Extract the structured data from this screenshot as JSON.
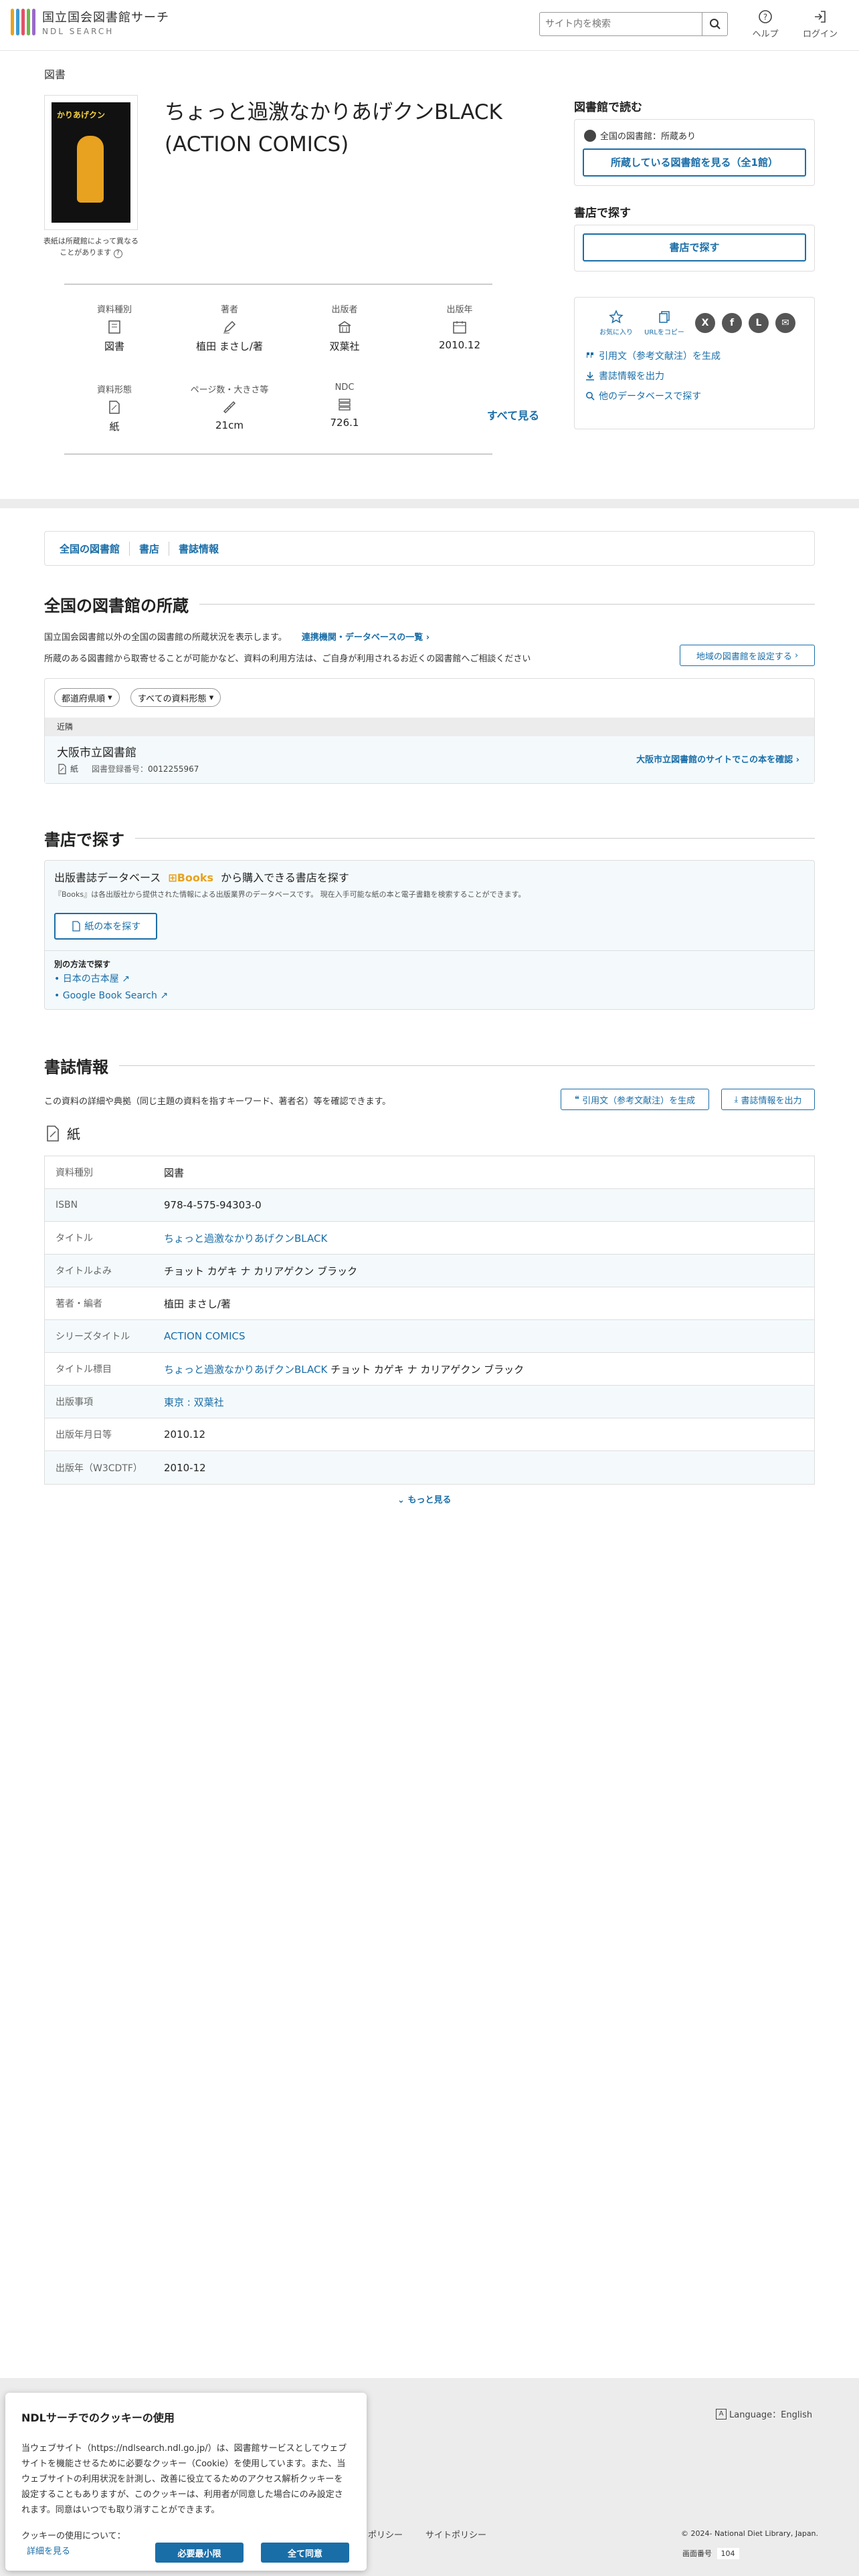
{
  "header": {
    "logo_title": "国立国会図書館サーチ",
    "logo_sub": "NDL SEARCH",
    "search_placeholder": "サイト内を検索",
    "help": "ヘルプ",
    "login": "ログイン"
  },
  "item": {
    "category": "図書",
    "title": "ちょっと過激なかりあげクンBLACK (ACTION COMICS)",
    "cover_note": "表紙は所蔵館によって異なることがあります",
    "cover_text": "かりあげクン",
    "meta": [
      {
        "label": "資料種別",
        "value": "図書",
        "icon": "book-icon"
      },
      {
        "label": "著者",
        "value": "植田 まさし/著",
        "icon": "pen-icon"
      },
      {
        "label": "出版者",
        "value": "双葉社",
        "icon": "building-icon"
      },
      {
        "label": "出版年",
        "value": "2010.12",
        "icon": "calendar-icon"
      },
      {
        "label": "資料形態",
        "value": "紙",
        "icon": "paper-icon"
      },
      {
        "label": "ページ数・大きさ等",
        "value": "21cm",
        "icon": "ruler-icon"
      },
      {
        "label": "NDC",
        "value": "726.1",
        "icon": "ndc-icon"
      }
    ],
    "see_all": "すべて見る"
  },
  "right": {
    "read_title": "図書館で読む",
    "hold_status": "全国の図書館：所蔵あり",
    "hold_button": "所蔵している図書館を見る（全1館）",
    "store_title": "書店で探す",
    "store_button": "書店で探す",
    "favorite": "お気に入り",
    "copy_url": "URLをコピー",
    "cite": "引用文（参考文献注）を生成",
    "export": "書誌情報を出力",
    "other_db": "他のデータベースで探す"
  },
  "anchors": [
    "全国の図書館",
    "書店",
    "書誌情報"
  ],
  "libraries": {
    "title": "全国の図書館の所蔵",
    "desc1": "国立国会図書館以外の全国の図書館の所蔵状況を表示します。",
    "link": "連携機関・データベースの一覧",
    "desc2": "所蔵のある図書館から取寄せることが可能かなど、資料の利用方法は、ご自身が利用されるお近くの図書館へご相談ください",
    "region_button": "地域の図書館を設定する",
    "filter_pref": "都道府県順",
    "filter_type": "すべての資料形態",
    "col_header": "近隣",
    "lib_name": "大阪市立図書館",
    "lib_form": "紙",
    "lib_reg_label": "図書登録番号：",
    "lib_reg": "0012255967",
    "lib_link": "大阪市立図書館のサイトでこの本を確認"
  },
  "store": {
    "title": "書店で探す",
    "db_label_pre": "出版書誌データベース",
    "db_name": "Books",
    "db_label_post": "から購入できる書店を探す",
    "db_desc": "『Books』は各出版社から提供された情報による出版業界のデータベースです。 現在入手可能な紙の本と電子書籍を検索することができます。",
    "paper_button": "紙の本を探す",
    "other_title": "別の方法で探す",
    "other_links": [
      "日本の古本屋",
      "Google Book Search"
    ]
  },
  "biblio": {
    "title": "書誌情報",
    "desc": "この資料の詳細や典拠（同じ主題の資料を指すキーワード、著者名）等を確認できます。",
    "cite_button": "引用文（参考文献注）を生成",
    "export_button": "書誌情報を出力",
    "form_heading": "紙",
    "rows": [
      {
        "k": "資料種別",
        "v": "図書",
        "link": false
      },
      {
        "k": "ISBN",
        "v": "978-4-575-94303-0",
        "link": false
      },
      {
        "k": "タイトル",
        "v": "ちょっと過激なかりあげクンBLACK",
        "link": true
      },
      {
        "k": "タイトルよみ",
        "v": "チョット カゲキ ナ カリアゲクン ブラック",
        "link": false
      },
      {
        "k": "著者・編者",
        "v": "植田 まさし/著",
        "link": false
      },
      {
        "k": "シリーズタイトル",
        "v": "ACTION COMICS",
        "link": true
      },
      {
        "k": "タイトル標目",
        "v": "ちょっと過激なかりあげクンBLACK",
        "v2": "チョット カゲキ ナ カリアゲクン ブラック",
        "link": true
      },
      {
        "k": "出版事項",
        "v": "東京 : 双葉社",
        "link": true
      },
      {
        "k": "出版年月日等",
        "v": "2010.12",
        "link": false
      },
      {
        "k": "出版年（W3CDTF）",
        "v": "2010-12",
        "link": false
      }
    ],
    "more": "もっと見る"
  },
  "footer": {
    "language": "Language：English",
    "policy1": "ポリシー",
    "policy2": "サイトポリシー",
    "copyright": "© 2024- National Diet Library, Japan.",
    "screen_label": "画面番号",
    "screen_no": "104"
  },
  "cookie": {
    "title": "NDLサーチでのクッキーの使用",
    "body": "当ウェブサイト（https://ndlsearch.ndl.go.jp/）は、図書館サービスとしてウェブサイトを機能させるために必要なクッキー（Cookie）を使用しています。また、当ウェブサイトの利用状況を計測し、改善に役立てるためのアクセス解析クッキーを設定することもありますが、このクッキーは、利用者が同意した場合にのみ設定されます。同意はいつでも取り消すことができます。",
    "about": "クッキーの使用について：",
    "details": "詳細を見る",
    "necessary": "必要最小限",
    "accept_all": "全て同意"
  },
  "colors": {
    "accent": "#1a6ea8",
    "logo_bars": [
      "#e8a220",
      "#3a9bd5",
      "#e0526b",
      "#6cb84a",
      "#9a6ac9"
    ]
  }
}
